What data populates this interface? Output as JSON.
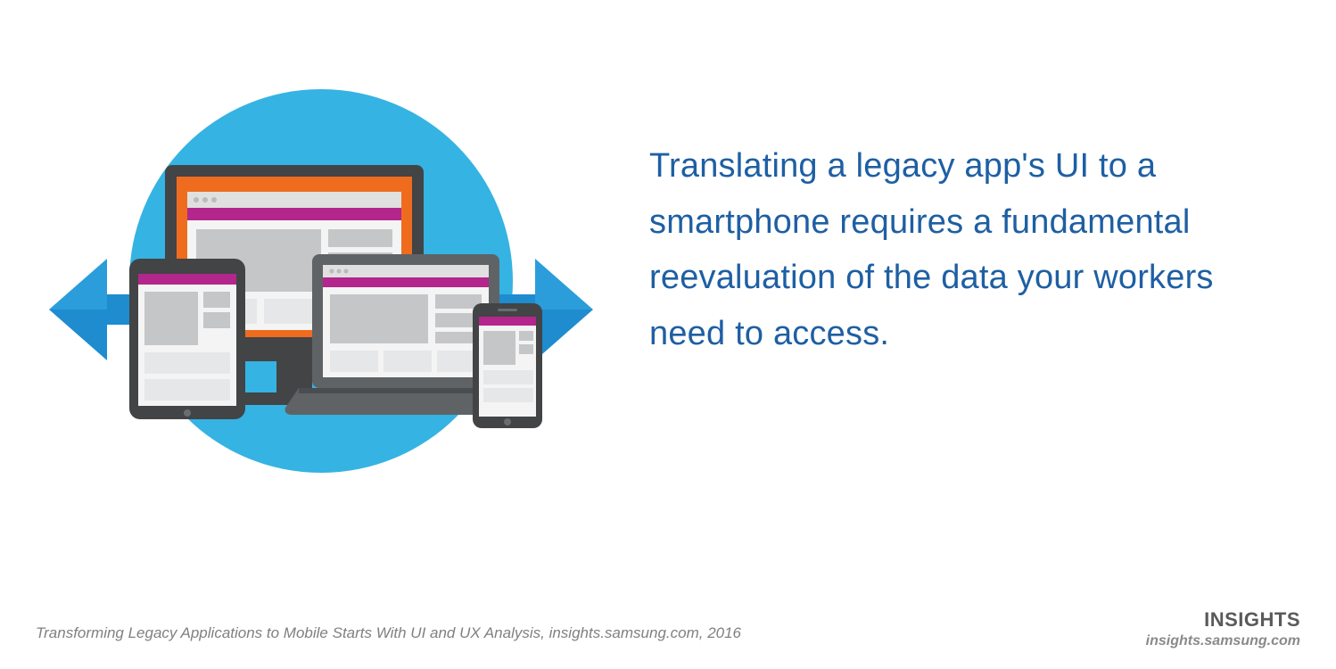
{
  "quote": "Translating a legacy app's UI to a smartphone requires a fundamental reevaluation of the data your workers need to access.",
  "source_line": "Transforming Legacy Applications to Mobile Starts With UI and UX Analysis, insights.samsung.com, 2016",
  "brand": "INSIGHTS",
  "brand_url": "insights.samsung.com",
  "colors": {
    "circle": "#35b3e3",
    "arrow": "#1e8ccf",
    "monitor_accent": "#ef6c1f",
    "header_bar": "#b3268b",
    "device_dark": "#424446",
    "device_mid": "#5f6366",
    "panel": "#e6e7e8",
    "panel_dark": "#c4c6c8",
    "text_blue": "#1e5fa3"
  }
}
